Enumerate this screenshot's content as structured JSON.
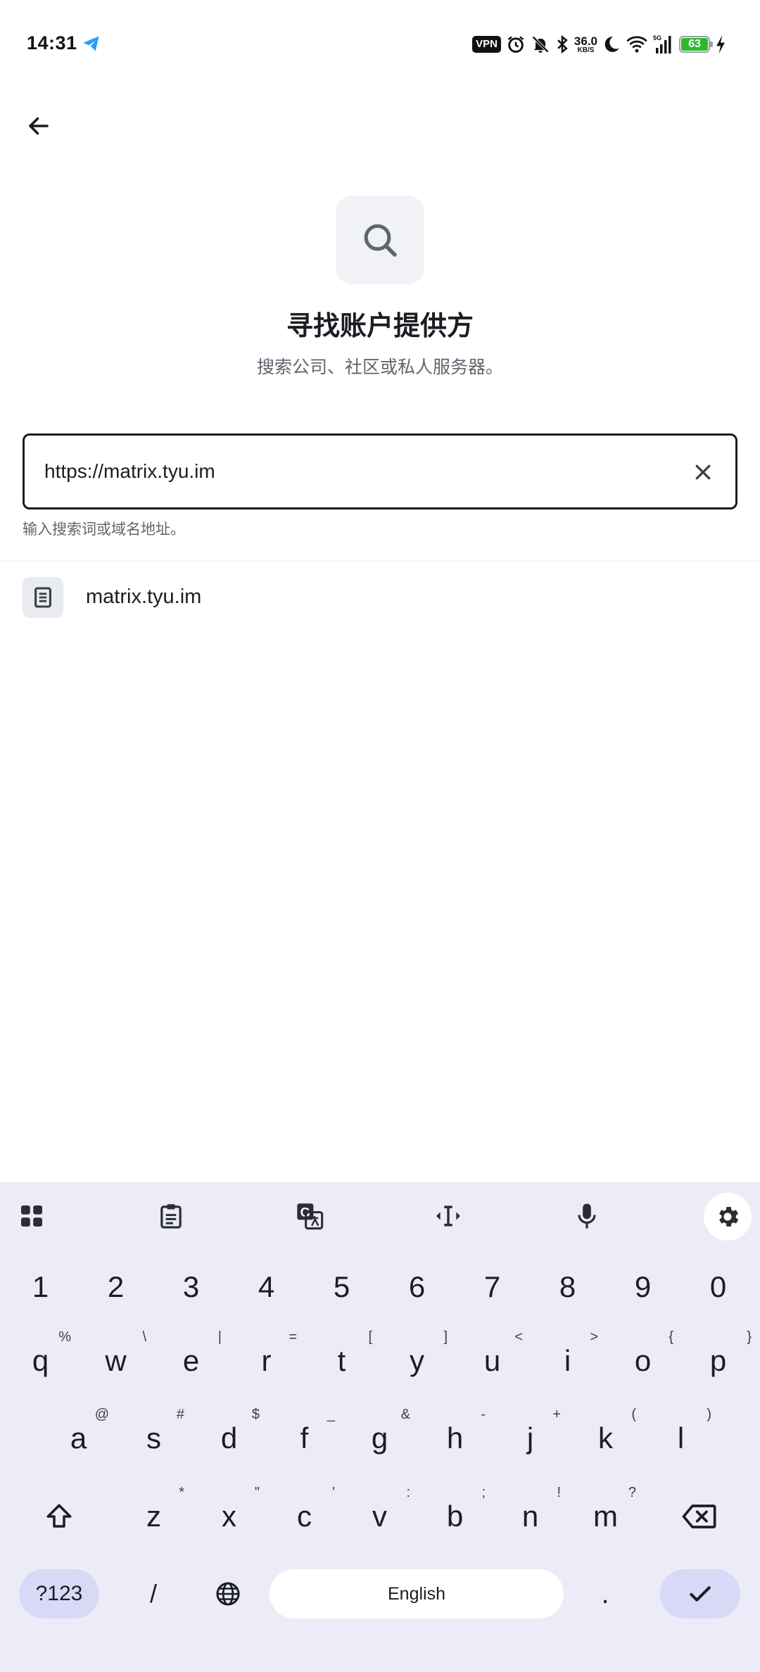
{
  "status_bar": {
    "time": "14:31",
    "vpn": "VPN",
    "net_speed_value": "36.0",
    "net_speed_unit": "KB/S",
    "network": "5G",
    "battery": "63"
  },
  "header": {
    "title": "寻找账户提供方",
    "subtitle": "搜索公司、社区或私人服务器。"
  },
  "search": {
    "value": "https://matrix.tyu.im",
    "helper": "输入搜索词或域名地址。"
  },
  "results": [
    {
      "label": "matrix.tyu.im"
    }
  ],
  "keyboard": {
    "numbers": [
      "1",
      "2",
      "3",
      "4",
      "5",
      "6",
      "7",
      "8",
      "9",
      "0"
    ],
    "row1": [
      {
        "k": "q",
        "h": "%"
      },
      {
        "k": "w",
        "h": "\\"
      },
      {
        "k": "e",
        "h": "|"
      },
      {
        "k": "r",
        "h": "="
      },
      {
        "k": "t",
        "h": "["
      },
      {
        "k": "y",
        "h": "]"
      },
      {
        "k": "u",
        "h": "<"
      },
      {
        "k": "i",
        "h": ">"
      },
      {
        "k": "o",
        "h": "{"
      },
      {
        "k": "p",
        "h": "}"
      }
    ],
    "row2": [
      {
        "k": "a",
        "h": "@"
      },
      {
        "k": "s",
        "h": "#"
      },
      {
        "k": "d",
        "h": "$"
      },
      {
        "k": "f",
        "h": "_"
      },
      {
        "k": "g",
        "h": "&"
      },
      {
        "k": "h",
        "h": "-"
      },
      {
        "k": "j",
        "h": "+"
      },
      {
        "k": "k",
        "h": "("
      },
      {
        "k": "l",
        "h": ")"
      }
    ],
    "row3": [
      {
        "k": "z",
        "h": "*"
      },
      {
        "k": "x",
        "h": "\""
      },
      {
        "k": "c",
        "h": "'"
      },
      {
        "k": "v",
        "h": ":"
      },
      {
        "k": "b",
        "h": ";"
      },
      {
        "k": "n",
        "h": "!"
      },
      {
        "k": "m",
        "h": "?"
      }
    ],
    "symbols_label": "?123",
    "slash_label": "/",
    "space_label": "English",
    "period_label": "."
  },
  "colors": {
    "keyboard_bg": "#ebecf8",
    "accent_pill": "#d9d8f6",
    "battery": "#2eb82e"
  }
}
